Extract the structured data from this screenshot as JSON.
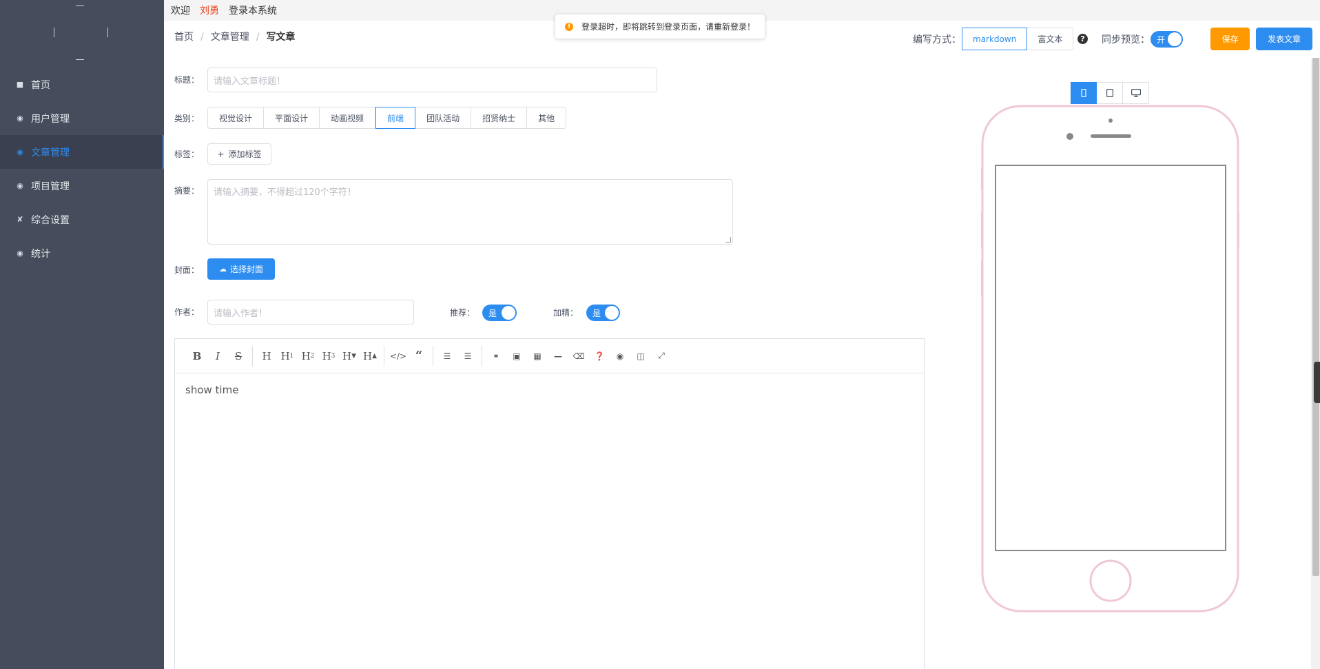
{
  "topbar": {
    "welcome": "欢迎",
    "user": "刘勇",
    "login_text": "登录本系统"
  },
  "notice": {
    "text": "登录超时，即将跳转到登录页面，请重新登录！",
    "icon": "warning-icon"
  },
  "sidebar": {
    "items": [
      {
        "label": "首页",
        "icon": "home-icon",
        "active": false
      },
      {
        "label": "用户管理",
        "icon": "users-icon",
        "active": false
      },
      {
        "label": "文章管理",
        "icon": "article-icon",
        "active": true
      },
      {
        "label": "项目管理",
        "icon": "project-icon",
        "active": false
      },
      {
        "label": "综合设置",
        "icon": "wrench-icon",
        "active": false
      },
      {
        "label": "统计",
        "icon": "stats-icon",
        "active": false
      }
    ]
  },
  "breadcrumb": {
    "home": "首页",
    "section": "文章管理",
    "current": "写文章",
    "separator": "/"
  },
  "toolbar": {
    "mode_label": "编写方式：",
    "modes": [
      "markdown",
      "富文本"
    ],
    "active_mode": "markdown",
    "sync_label": "同步预览：",
    "sync_state": "开",
    "save": "保存",
    "publish": "发表文章"
  },
  "form": {
    "title_label": "标题：",
    "title_placeholder": "请输入文章标题！",
    "category_label": "类别：",
    "categories": [
      "视觉设计",
      "平面设计",
      "动画视频",
      "前端",
      "团队活动",
      "招贤纳士",
      "其他"
    ],
    "active_category": "前端",
    "tag_label": "标签：",
    "add_tag": "添加标签",
    "summary_label": "摘要：",
    "summary_placeholder": "请输入摘要，不得超过120个字符！",
    "cover_label": "封面：",
    "cover_button": "选择封面",
    "author_label": "作者：",
    "author_placeholder": "请输入作者！",
    "recommend_label": "推荐：",
    "recommend_value": "是",
    "featured_label": "加精：",
    "featured_value": "是"
  },
  "editor": {
    "content": "show time",
    "toolbar": [
      "bold-icon",
      "italic-icon",
      "strikethrough-icon",
      "heading-icon",
      "heading-1-icon",
      "heading-2-icon",
      "heading-3-icon",
      "heading-smaller-icon",
      "heading-bigger-icon",
      "code-icon",
      "quote-icon",
      "unordered-list-icon",
      "ordered-list-icon",
      "link-icon",
      "image-icon",
      "table-icon",
      "horizontal-rule-icon",
      "eraser-icon",
      "guide-icon",
      "preview-icon",
      "side-by-side-icon",
      "fullscreen-icon"
    ]
  },
  "preview": {
    "devices": [
      "phone-icon",
      "tablet-icon",
      "desktop-icon"
    ],
    "active_device": "phone-icon"
  },
  "colors": {
    "primary": "#2d8cf0",
    "warning": "#ff9900",
    "sidebar_bg": "#464c5b",
    "phone_outline": "#f0c8d3"
  }
}
